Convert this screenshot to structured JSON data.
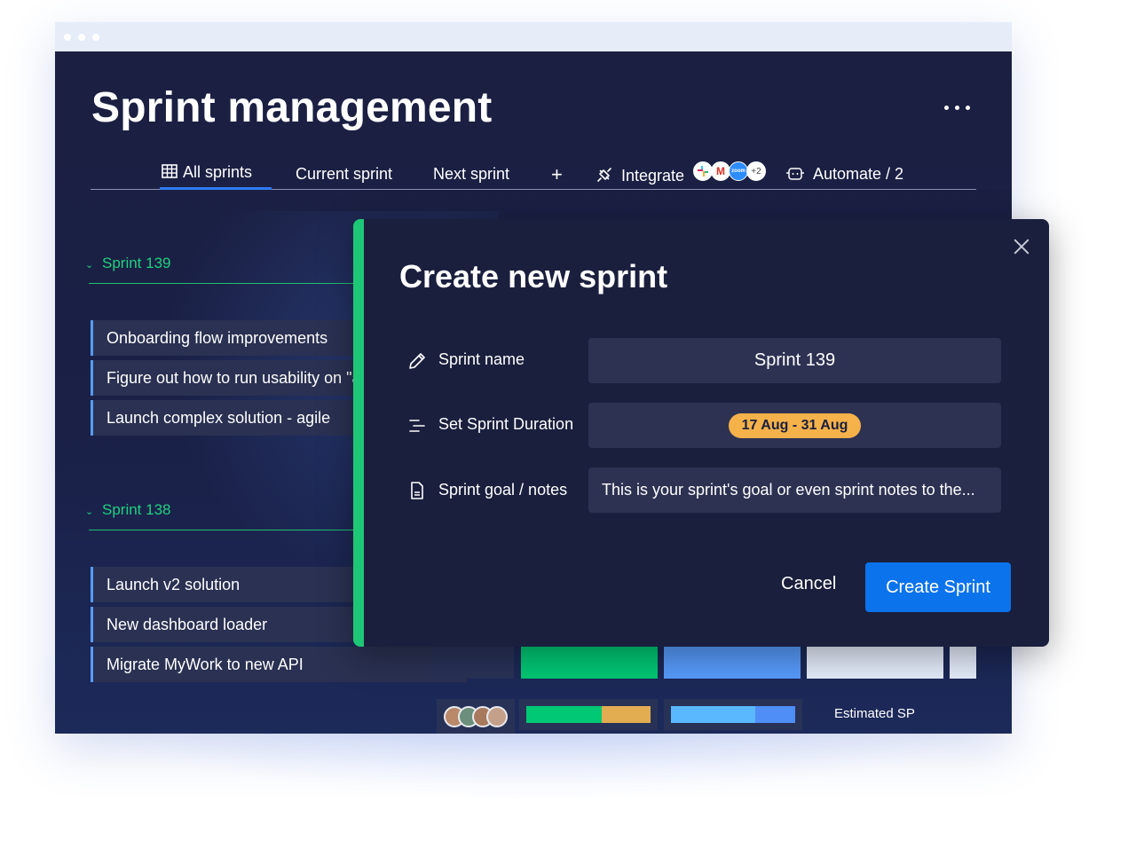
{
  "app": {
    "title": "Sprint management"
  },
  "tabs": [
    {
      "label": "All sprints",
      "icon": "table-icon",
      "active": true
    },
    {
      "label": "Current sprint"
    },
    {
      "label": "Next sprint"
    },
    {
      "label": "+"
    }
  ],
  "integrate": {
    "label": "Integrate",
    "icon": "plug-icon",
    "extra_count": "+2",
    "apps": [
      "slack-icon",
      "gmail-icon",
      "zoom-icon"
    ],
    "zoom_text": "zoom"
  },
  "automate": {
    "label": "Automate / 2",
    "icon": "robot-icon"
  },
  "groups": [
    {
      "name": "Sprint 139",
      "color": "#1fd17e",
      "tasks": [
        "Onboarding flow improvements",
        "Figure out how to run usability on \"a",
        "Launch complex solution - agile"
      ]
    },
    {
      "name": "Sprint 138",
      "color": "#1fd17e",
      "tasks": [
        "Launch v2 solution",
        "New dashboard loader",
        "Migrate MyWork to new API"
      ]
    }
  ],
  "summary": {
    "estimated_label": "Estimated SP",
    "status_segments": [
      0.61,
      0.39
    ],
    "priority_segments": [
      0.68,
      0.32
    ]
  },
  "modal": {
    "title": "Create new sprint",
    "fields": [
      {
        "label": "Sprint name",
        "icon": "pencil-icon",
        "value": "Sprint 139"
      },
      {
        "label": "Set Sprint Duration",
        "icon": "timeline-icon",
        "value": "17 Aug - 31 Aug"
      },
      {
        "label": "Sprint goal / notes",
        "icon": "document-icon",
        "placeholder": "This is your sprint's goal or even sprint notes to the..."
      }
    ],
    "cancel_label": "Cancel",
    "create_label": "Create Sprint"
  },
  "colors": {
    "background": "#1a1f3d",
    "accent_green": "#1ec776",
    "primary_blue": "#0b73eb",
    "date_pill": "#f5b24a",
    "task_border": "#579bfc"
  }
}
